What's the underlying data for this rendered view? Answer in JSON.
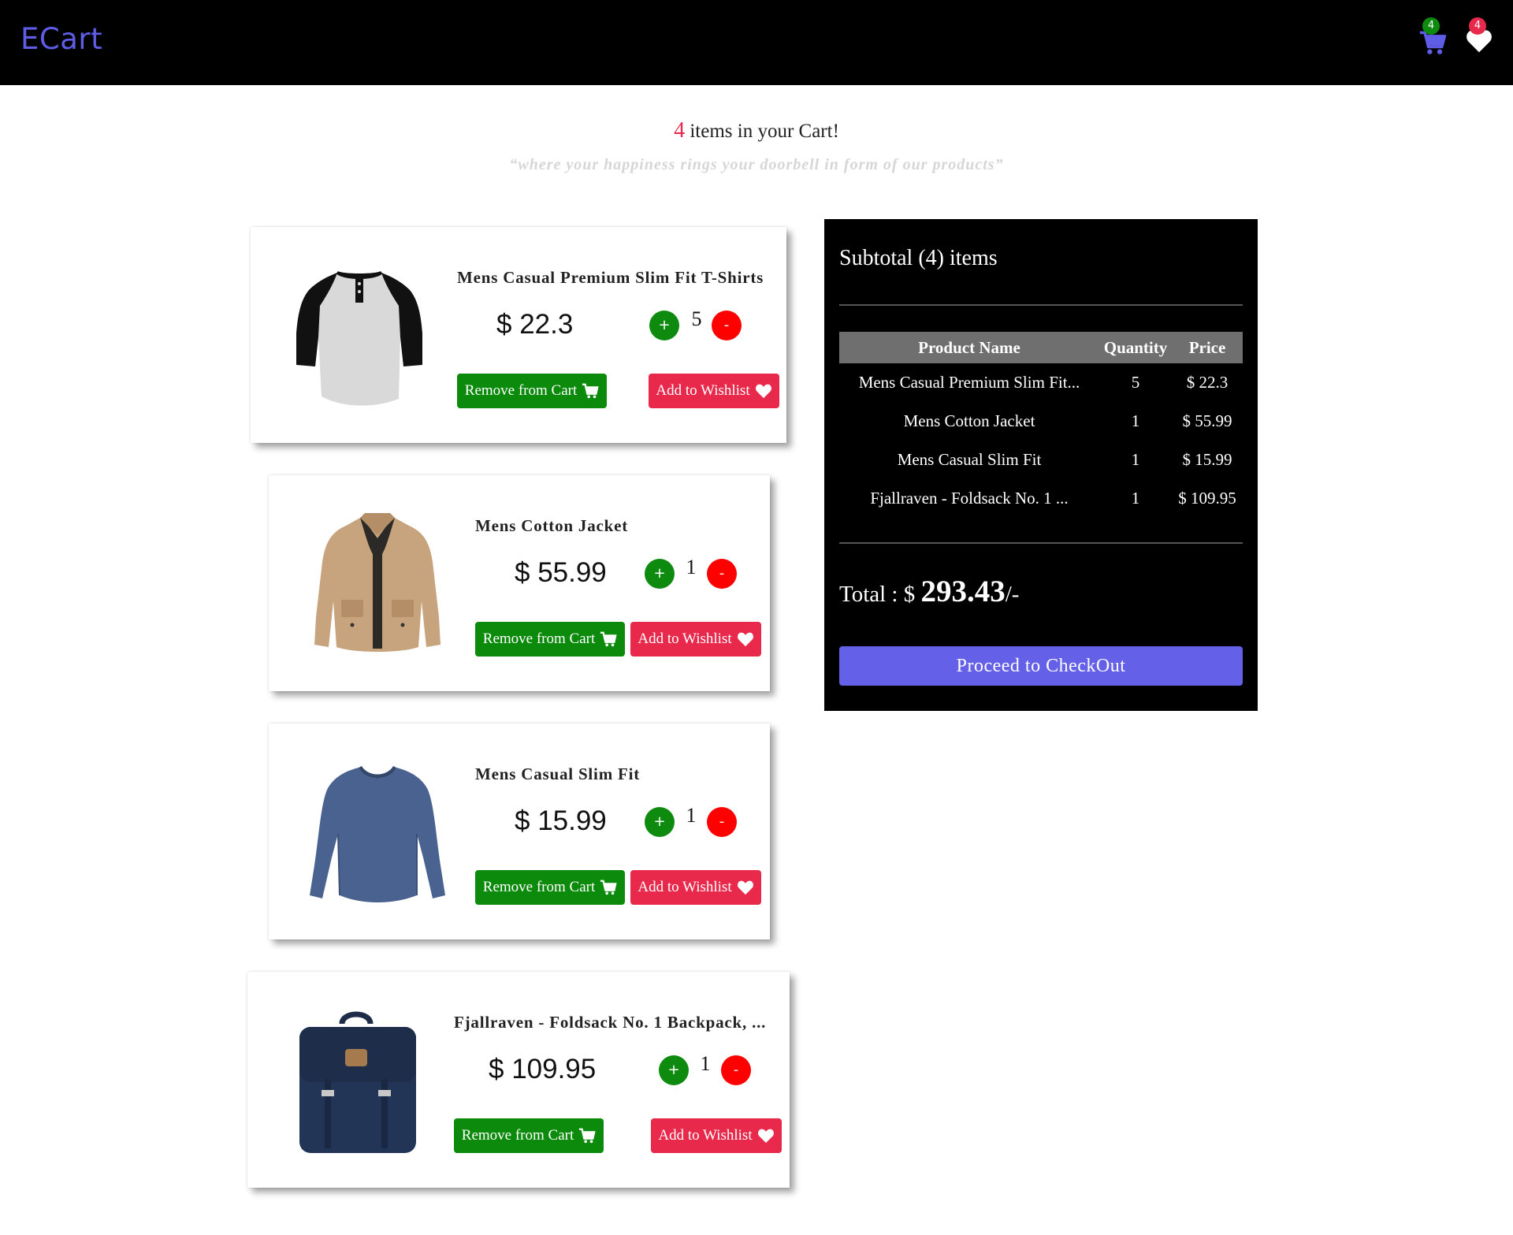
{
  "navbar": {
    "brand": "ECart",
    "cart_count": "4",
    "wishlist_count": "4",
    "icons": [
      "shopping-cart-icon",
      "heart-icon"
    ]
  },
  "headline": {
    "count": "4",
    "text": " items in your Cart!",
    "tagline": "“where your happiness rings your doorbell in form of our products”"
  },
  "cart_items": [
    {
      "title": "Mens Casual Premium Slim Fit T-Shirts",
      "price": "$ 22.3",
      "qty": "5",
      "plus": "+",
      "minus": "-",
      "remove_label": "Remove from Cart",
      "wish_label": "Add to Wishlist"
    },
    {
      "title": "Mens Cotton Jacket",
      "price": "$ 55.99",
      "qty": "1",
      "plus": "+",
      "minus": "-",
      "remove_label": "Remove from Cart",
      "wish_label": "Add to Wishlist"
    },
    {
      "title": "Mens Casual Slim Fit",
      "price": "$ 15.99",
      "qty": "1",
      "plus": "+",
      "minus": "-",
      "remove_label": "Remove from Cart",
      "wish_label": "Add to Wishlist"
    },
    {
      "title": "Fjallraven - Foldsack No. 1 Backpack, ...",
      "price": "$ 109.95",
      "qty": "1",
      "plus": "+",
      "minus": "-",
      "remove_label": "Remove from Cart",
      "wish_label": "Add to Wishlist"
    }
  ],
  "summary": {
    "title": "Subtotal (4) items",
    "headers": [
      "Product Name",
      "Quantity",
      "Price"
    ],
    "rows": [
      [
        "Mens Casual Premium Slim Fit...",
        "5",
        "$ 22.3"
      ],
      [
        "Mens Cotton Jacket",
        "1",
        "$ 55.99"
      ],
      [
        "Mens Casual Slim Fit",
        "1",
        "$ 15.99"
      ],
      [
        "Fjallraven - Foldsack No. 1 ...",
        "1",
        "$ 109.95"
      ]
    ],
    "total_label": "Total : $ ",
    "total_amount": "293.43",
    "total_suffix": "/-",
    "checkout_label": "Proceed to CheckOut"
  },
  "colors": {
    "brand": "#5f5ce6",
    "success": "#0b8a0b",
    "danger": "#e8294c",
    "minus": "#ff0000",
    "checkout": "#6461e8"
  }
}
